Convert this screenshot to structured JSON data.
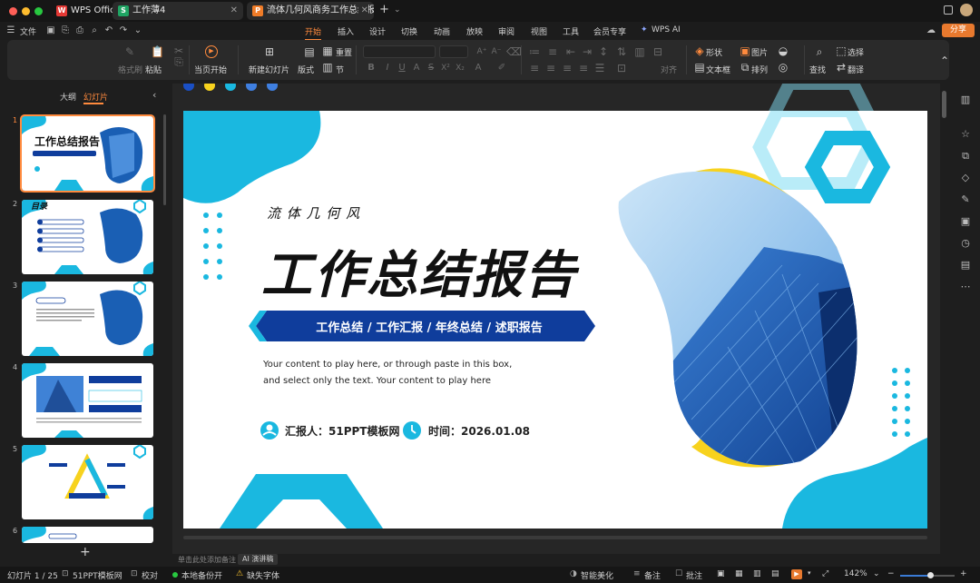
{
  "titlebar": {
    "tabs": [
      {
        "label": "WPS Office",
        "icon": "wps-logo-icon",
        "icon_color": "#e53935"
      },
      {
        "label": "工作薄4",
        "icon": "spreadsheet-icon",
        "icon_color": "#1fa463"
      },
      {
        "label": "流体几何风商务工作总结报",
        "icon": "presentation-icon",
        "icon_color": "#f07c28"
      }
    ],
    "new_tab": "+",
    "share_label": "分享"
  },
  "menubar": {
    "file_label": "文件",
    "tabs": [
      "开始",
      "插入",
      "设计",
      "切换",
      "动画",
      "放映",
      "审阅",
      "视图",
      "工具",
      "会员专享"
    ],
    "active_tab": "开始",
    "ai_label": "WPS AI"
  },
  "ribbon": {
    "format_brush": "格式刷",
    "paste": "粘贴",
    "play_from_current": "当页开始",
    "new_slide": "新建幻灯片",
    "layout": "版式",
    "reset": "重置",
    "section": "节",
    "align": "对齐",
    "shape": "形状",
    "picture": "图片",
    "textbox": "文本框",
    "arrange": "排列",
    "find": "查找",
    "select": "选择",
    "translate": "翻译"
  },
  "left_panel": {
    "tab_outline": "大纲",
    "tab_slides": "幻灯片",
    "active_tab": "幻灯片",
    "slide_numbers": [
      "1",
      "2",
      "3",
      "4",
      "5",
      "6"
    ],
    "thumb2_title": "目录",
    "add_button": "+"
  },
  "slide": {
    "subtitle": "流 体 几 何 风",
    "title": "工作总结报告",
    "banner": "工作总结 / 工作汇报 / 年终总结 / 述职报告",
    "body_line1": "Your content to play here, or through paste in this box,",
    "body_line2": "and select only the text. Your content to play here",
    "reporter": "汇报人：51PPT模板网",
    "time": "时间：2026.01.08",
    "colors": {
      "cyan": "#1ab8e0",
      "navy": "#0f3d9c",
      "yellow": "#f7d21e",
      "black": "#111111"
    }
  },
  "notes": {
    "placeholder": "单击此处添加备注",
    "ai_script": "AI 演讲稿"
  },
  "statusbar": {
    "slide_counter": "幻灯片 1 / 25",
    "template": "51PPT模板网",
    "proofread": "校对",
    "backup": "本地备份开",
    "missing_font": "缺失字体",
    "smart_beautify": "智能美化",
    "notes": "备注",
    "comments": "批注",
    "zoom": "142%",
    "zoom_fraction": 0.55
  }
}
